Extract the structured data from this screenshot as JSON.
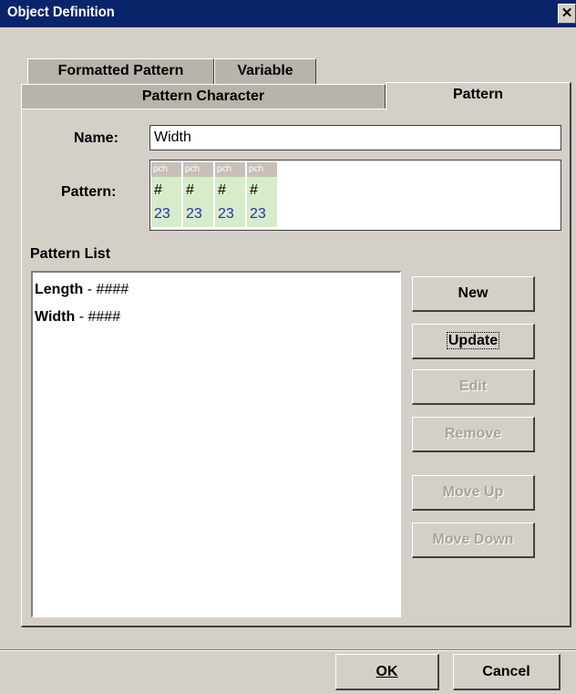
{
  "window": {
    "title": "Object Definition",
    "close_glyph": "✕"
  },
  "tabs": {
    "row1": [
      {
        "label": "Formatted Pattern"
      },
      {
        "label": "Variable"
      }
    ],
    "row2": [
      {
        "label": "Pattern Character"
      },
      {
        "label": "Pattern",
        "selected": true
      }
    ]
  },
  "form": {
    "name_label": "Name:",
    "name_value": "Width",
    "pattern_label": "Pattern:",
    "pattern_cells": [
      {
        "header": "pch",
        "char": "#",
        "code": "23"
      },
      {
        "header": "pch",
        "char": "#",
        "code": "23"
      },
      {
        "header": "pch",
        "char": "#",
        "code": "23"
      },
      {
        "header": "pch",
        "char": "#",
        "code": "23"
      }
    ]
  },
  "pattern_list": {
    "label": "Pattern List",
    "items": [
      {
        "name": "Length",
        "rest": " - ####"
      },
      {
        "name": "Width",
        "rest": " - ####"
      }
    ]
  },
  "side_buttons": [
    {
      "label": "New",
      "enabled": true
    },
    {
      "label": "Update",
      "enabled": true,
      "focused": true
    },
    {
      "label": "Edit",
      "enabled": false
    },
    {
      "label": "Remove",
      "enabled": false
    },
    {
      "label": "Move Up",
      "enabled": false
    },
    {
      "label": "Move Down",
      "enabled": false
    }
  ],
  "footer": {
    "ok_label": "OK",
    "cancel_label": "Cancel"
  },
  "colors": {
    "titlebar": "#0a246a",
    "pattern_cell_bg": "#d7ecc8",
    "pattern_header_bg": "#c8c0b8",
    "pattern_code": "#2233aa"
  }
}
